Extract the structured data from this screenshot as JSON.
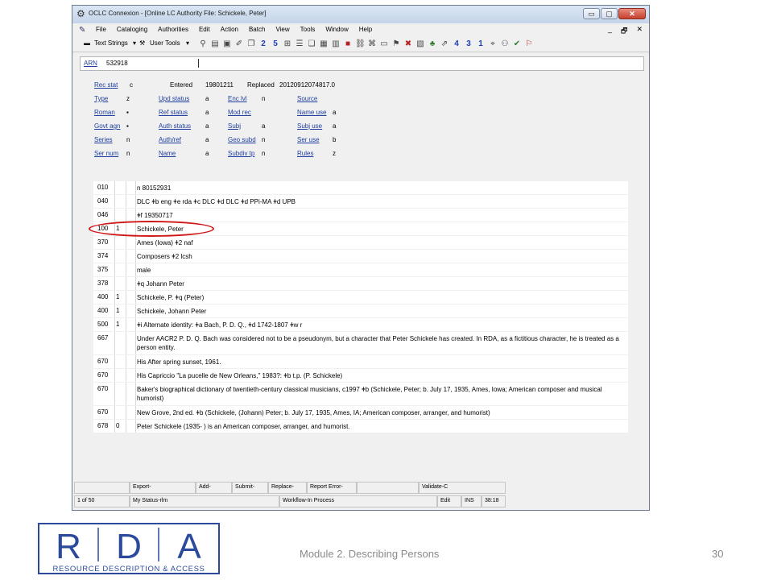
{
  "window": {
    "title": "OCLC Connexion - [Online LC Authority File: Schickele, Peter]",
    "buttons": {
      "minimize": "▭",
      "restore": "▢",
      "close": "✕"
    }
  },
  "menu": {
    "items": [
      "File",
      "Cataloging",
      "Authorities",
      "Edit",
      "Action",
      "Batch",
      "View",
      "Tools",
      "Window",
      "Help"
    ],
    "mdi": [
      "_",
      "🗗",
      "✕"
    ]
  },
  "toolbar": {
    "text_strings": "Text Strings",
    "user_tools": "User Tools",
    "dropdown": "▾",
    "numbers": [
      "2",
      "5",
      "4",
      "3",
      "1"
    ]
  },
  "arn": {
    "label": "ARN",
    "value": "532918"
  },
  "fixed_field": {
    "row1": {
      "rec_stat_label": "Rec stat",
      "rec_stat": "c",
      "entered_label": "Entered",
      "entered": "19801211",
      "replaced_label": "Replaced",
      "replaced": "20120912074817.0"
    },
    "rows": [
      [
        {
          "label": "Type",
          "value": "z"
        },
        {
          "label": "Upd status",
          "value": "a"
        },
        {
          "label": "Enc lvl",
          "value": "n"
        },
        {
          "label": "Source",
          "value": ""
        }
      ],
      [
        {
          "label": "Roman",
          "value": "▪"
        },
        {
          "label": "Ref status",
          "value": "a"
        },
        {
          "label": "Mod rec",
          "value": ""
        },
        {
          "label": "Name use",
          "value": "a"
        }
      ],
      [
        {
          "label": "Govt agn",
          "value": "▪"
        },
        {
          "label": "Auth status",
          "value": "a"
        },
        {
          "label": "Subj",
          "value": "a"
        },
        {
          "label": "Subj use",
          "value": "a"
        }
      ],
      [
        {
          "label": "Series",
          "value": "n"
        },
        {
          "label": "Auth/ref",
          "value": "a"
        },
        {
          "label": "Geo subd",
          "value": "n"
        },
        {
          "label": "Ser use",
          "value": "b"
        }
      ],
      [
        {
          "label": "Ser num",
          "value": "n"
        },
        {
          "label": "Name",
          "value": "a"
        },
        {
          "label": "Subdiv tp",
          "value": "n"
        },
        {
          "label": "Rules",
          "value": "z"
        }
      ]
    ]
  },
  "fields": [
    {
      "tag": "010",
      "ind1": "",
      "ind2": "",
      "data": "n 80152931"
    },
    {
      "tag": "040",
      "ind1": "",
      "ind2": "",
      "data": "DLC ǂb eng ǂe rda ǂc DLC ǂd DLC ǂd PPi-MA ǂd UPB"
    },
    {
      "tag": "046",
      "ind1": "",
      "ind2": "",
      "data": "ǂf 19350717"
    },
    {
      "tag": "100",
      "ind1": "1",
      "ind2": "",
      "data": "Schickele, Peter"
    },
    {
      "tag": "370",
      "ind1": "",
      "ind2": "",
      "data": "Ames (Iowa) ǂ2 naf"
    },
    {
      "tag": "374",
      "ind1": "",
      "ind2": "",
      "data": "Composers ǂ2 lcsh"
    },
    {
      "tag": "375",
      "ind1": "",
      "ind2": "",
      "data": "male"
    },
    {
      "tag": "378",
      "ind1": "",
      "ind2": "",
      "data": "ǂq Johann Peter"
    },
    {
      "tag": "400",
      "ind1": "1",
      "ind2": "",
      "data": "Schickele, P. ǂq (Peter)"
    },
    {
      "tag": "400",
      "ind1": "1",
      "ind2": "",
      "data": "Schickele, Johann Peter"
    },
    {
      "tag": "500",
      "ind1": "1",
      "ind2": "",
      "data": "ǂi Alternate identity: ǂa Bach, P. D. Q., ǂd 1742-1807 ǂw r"
    },
    {
      "tag": "667",
      "ind1": "",
      "ind2": "",
      "data": "Under AACR2 P. D. Q. Bach was considered not to be a pseudonym, but a character that Peter Schickele has created. In RDA, as a fictitious character, he is treated as a person entity."
    },
    {
      "tag": "670",
      "ind1": "",
      "ind2": "",
      "data": "His After spring sunset, 1961."
    },
    {
      "tag": "670",
      "ind1": "",
      "ind2": "",
      "data": "His Capriccio \"La pucelle de New Orleans,\" 1983?: ǂb t.p. (P. Schickele)"
    },
    {
      "tag": "670",
      "ind1": "",
      "ind2": "",
      "data": "Baker's biographical dictionary of twentieth-century classical musicians, c1997 ǂb (Schickele, Peter; b. July 17, 1935, Ames, Iowa; American composer and musical humorist)"
    },
    {
      "tag": "670",
      "ind1": "",
      "ind2": "",
      "data": "New Grove, 2nd ed. ǂb (Schickele, (Johann) Peter; b. July 17, 1935, Ames, IA; American composer, arranger, and humorist)"
    },
    {
      "tag": "678",
      "ind1": "0",
      "ind2": "",
      "data": "Peter Schickele (1935- ) is an American composer, arranger, and humorist."
    }
  ],
  "status_bar": {
    "row1": [
      "Export-",
      "Add-",
      "Submit-",
      "Replace-",
      "Report Error-",
      "Validate-C"
    ],
    "row2": {
      "position": "1 of 50",
      "status": "My Status-rlm",
      "workflow": "Workflow-In Process",
      "mode": "Edit",
      "ins": "INS",
      "time": "38:18"
    }
  },
  "slide": {
    "footer": "Module 2. Describing Persons",
    "page_number": "30",
    "logo_letters": [
      "R",
      "D",
      "A"
    ],
    "logo_tagline": "RESOURCE DESCRIPTION & ACCESS",
    "logo_color": "#2b4a9b",
    "highlight_color": "#d01818"
  }
}
